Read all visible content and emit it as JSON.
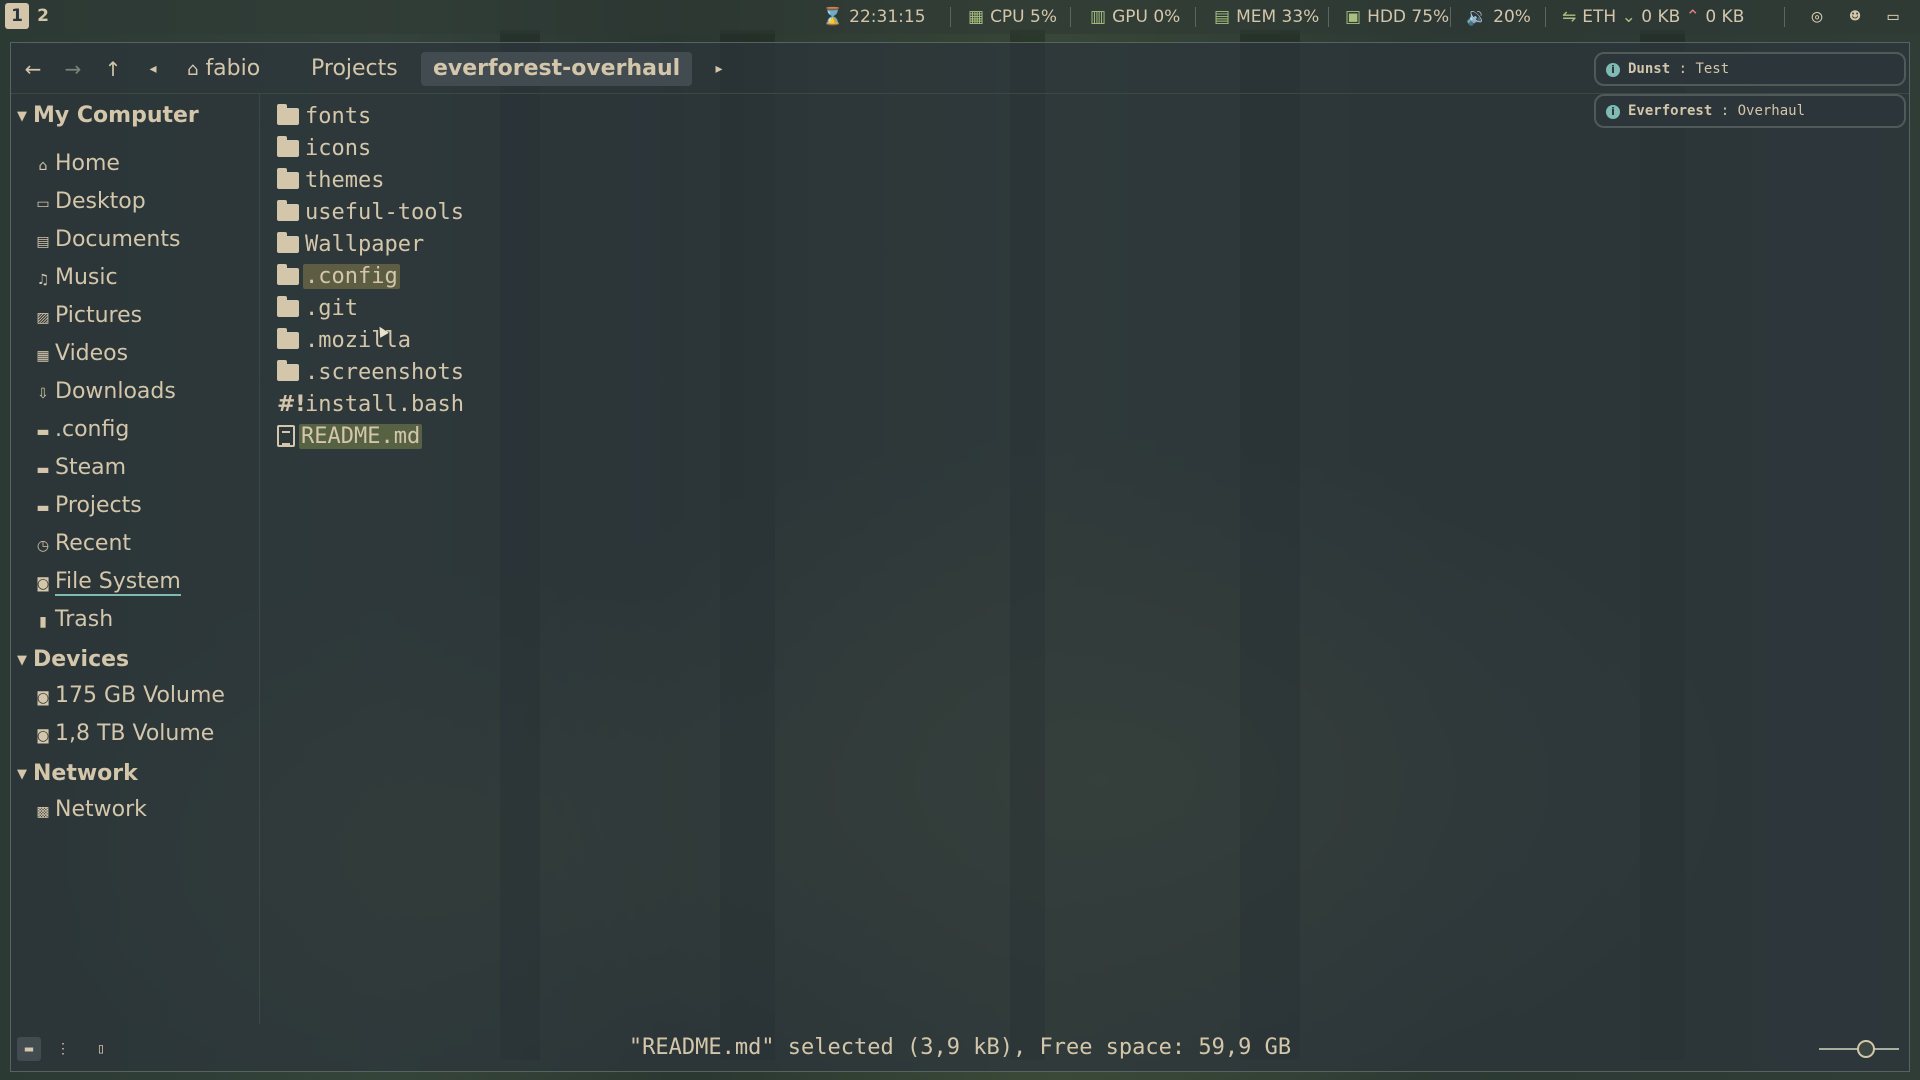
{
  "topbar": {
    "workspaces": [
      "1",
      "2"
    ],
    "clock": "22:31:15",
    "cpu": "CPU 5%",
    "gpu": "GPU 0%",
    "mem": "MEM 33%",
    "hdd": "HDD 75%",
    "volume": "20%",
    "net_label": "ETH",
    "net_down": "0 KB",
    "net_up": "0 KB",
    "tray_icons": [
      "steam-icon",
      "discord-icon",
      "screen-icon"
    ]
  },
  "toolbar": {
    "back": "←",
    "forward": "→",
    "up": "↑",
    "crumb_prev": "◂",
    "crumb_next": "▸",
    "breadcrumbs": [
      "fabio",
      "Projects",
      "everforest-overhaul"
    ]
  },
  "sidebar": {
    "sections": {
      "my_computer": "My Computer",
      "devices": "Devices",
      "network": "Network"
    },
    "places": [
      "Home",
      "Desktop",
      "Documents",
      "Music",
      "Pictures",
      "Videos",
      "Downloads",
      ".config",
      "Steam",
      "Projects",
      "Recent",
      "File System",
      "Trash"
    ],
    "devices": [
      "175 GB Volume",
      "1,8 TB Volume"
    ],
    "network": [
      "Network"
    ]
  },
  "files": [
    {
      "name": "fonts",
      "type": "folder"
    },
    {
      "name": "icons",
      "type": "folder"
    },
    {
      "name": "themes",
      "type": "folder"
    },
    {
      "name": "useful-tools",
      "type": "folder"
    },
    {
      "name": "Wallpaper",
      "type": "folder"
    },
    {
      "name": ".config",
      "type": "folder",
      "state": "hovered"
    },
    {
      "name": ".git",
      "type": "folder"
    },
    {
      "name": ".mozilla",
      "type": "folder"
    },
    {
      "name": ".screenshots",
      "type": "folder"
    },
    {
      "name": "install.bash",
      "type": "script"
    },
    {
      "name": "README.md",
      "type": "document",
      "state": "selected"
    }
  ],
  "status": {
    "text": "\"README.md\" selected (3,9 kB), Free space: 59,9 GB"
  },
  "notifications": [
    {
      "app": "Dunst",
      "sep": " : ",
      "body": "Test"
    },
    {
      "app": "Everforest",
      "sep": " : ",
      "body": "Overhaul"
    }
  ],
  "colors": {
    "accent": "#a7c080",
    "fg": "#d3c6aa",
    "bg": "#2d353b",
    "info": "#7fbbb3",
    "selection": "#566243"
  }
}
